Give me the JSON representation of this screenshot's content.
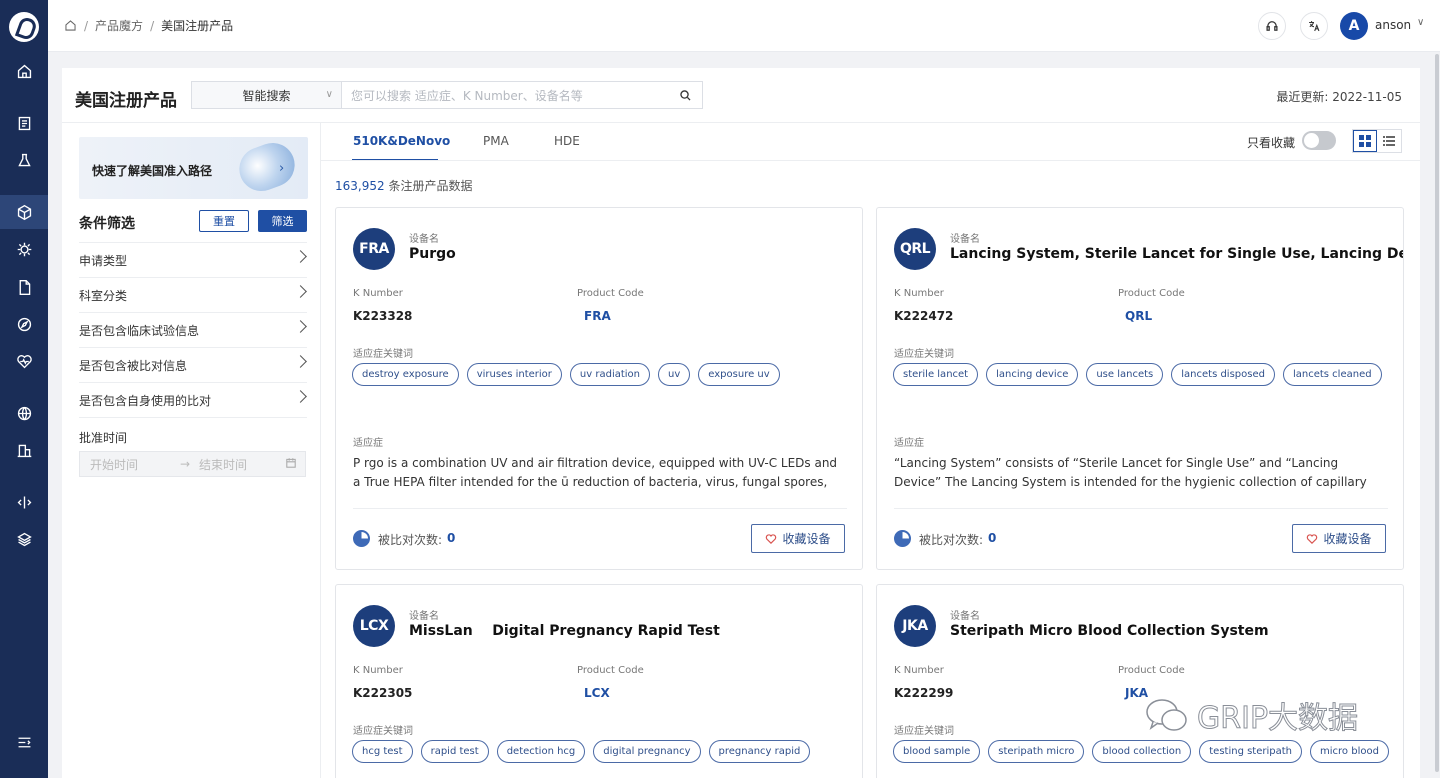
{
  "header": {
    "breadcrumb": [
      "产品魔方",
      "美国注册产品"
    ],
    "user_initial": "A",
    "user_name": "anson"
  },
  "page": {
    "title": "美国注册产品",
    "search_mode": "智能搜索",
    "search_placeholder": "您可以搜索 适应症、K Number、设备名等",
    "updated_label": "最近更新: 2022-11-05"
  },
  "sidebar": {
    "banner_text": "快速了解美国准入路径",
    "filter_title": "条件筛选",
    "reset_label": "重置",
    "filter_label": "筛选",
    "filters": [
      "申请类型",
      "科室分类",
      "是否包含临床试验信息",
      "是否包含被比对信息",
      "是否包含自身使用的比对"
    ],
    "date_label": "批准时间",
    "date_start_placeholder": "开始时间",
    "date_end_placeholder": "结束时间"
  },
  "tabs": [
    "510K&DeNovo",
    "PMA",
    "HDE"
  ],
  "favorites_only_label": "只看收藏",
  "result_count": "163,952",
  "result_suffix": " 条注册产品数据",
  "labels": {
    "device_name": "设备名",
    "k_number": "K Number",
    "product_code": "Product Code",
    "keywords": "适应症关键词",
    "indication": "适应症",
    "compared_count": "被比对次数:",
    "favorite": "收藏设备"
  },
  "cards": [
    {
      "badge": "FRA",
      "name": "Purgo",
      "k_number": "K223328",
      "product_code": "FRA",
      "tags": [
        "destroy exposure",
        "viruses interior",
        "uv radiation",
        "uv",
        "exposure uv"
      ],
      "indication": "P rgo is a combination UV and air filtration device, equipped with UV-C LEDs and a True HEPA filter intended for the ū reduction of bacteria, virus, fungal spores, and particles in...",
      "compared": "0"
    },
    {
      "badge": "QRL",
      "name": "Lancing System, Sterile Lancet for Single Use, Lancing Device",
      "k_number": "K222472",
      "product_code": "QRL",
      "tags": [
        "sterile lancet",
        "lancing device",
        "use lancets",
        "lancets disposed",
        "lancets cleaned"
      ],
      "indication": "“Lancing System” consists of “Sterile Lancet for Single Use” and “Lancing Device” The Lancing System is intended for the hygienic collection of capillary blood for testing...",
      "compared": "0"
    },
    {
      "badge": "LCX",
      "name": "MissLan    Digital Pregnancy Rapid Test",
      "k_number": "K222305",
      "product_code": "LCX",
      "tags": [
        "hcg test",
        "rapid test",
        "detection hcg",
        "digital pregnancy",
        "pregnancy rapid"
      ],
      "indication": "",
      "compared": ""
    },
    {
      "badge": "JKA",
      "name": "Steripath Micro Blood Collection System",
      "k_number": "K222299",
      "product_code": "JKA",
      "tags": [
        "blood sample",
        "steripath micro",
        "blood collection",
        "testing steripath",
        "micro blood"
      ],
      "indication": "",
      "compared": ""
    }
  ],
  "watermark": "GRIP大数据",
  "colors": {
    "rail": "#1a2d57",
    "primary": "#1f4fa4",
    "badge": "#1d3e7c"
  }
}
